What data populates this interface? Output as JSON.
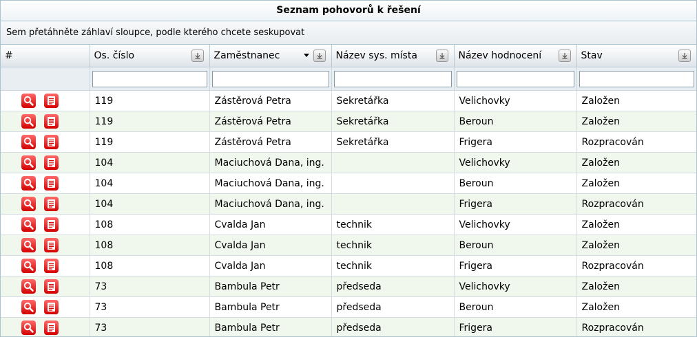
{
  "title": "Seznam pohovorů k řešení",
  "group_hint": "Sem přetáhněte záhlaví sloupce, podle kterého chcete seskupovat",
  "columns": [
    {
      "label": "#"
    },
    {
      "label": "Os. číslo"
    },
    {
      "label": "Zaměstnanec"
    },
    {
      "label": "Název sys. místa"
    },
    {
      "label": "Název hodnocení"
    },
    {
      "label": "Stav"
    }
  ],
  "rows": [
    {
      "os": "119",
      "emp": "Zástěrová Petra",
      "place": "Sekretářka",
      "eval": "Velichovky",
      "state": "Založen"
    },
    {
      "os": "119",
      "emp": "Zástěrová Petra",
      "place": "Sekretářka",
      "eval": "Beroun",
      "state": "Založen"
    },
    {
      "os": "119",
      "emp": "Zástěrová Petra",
      "place": "Sekretářka",
      "eval": "Frigera",
      "state": "Rozpracován"
    },
    {
      "os": "104",
      "emp": "Maciuchová Dana, ing.",
      "place": "",
      "eval": "Velichovky",
      "state": "Založen"
    },
    {
      "os": "104",
      "emp": "Maciuchová Dana, ing.",
      "place": "",
      "eval": "Beroun",
      "state": "Založen"
    },
    {
      "os": "104",
      "emp": "Maciuchová Dana, ing.",
      "place": "",
      "eval": "Frigera",
      "state": "Rozpracován"
    },
    {
      "os": "108",
      "emp": "Cvalda Jan",
      "place": "technik",
      "eval": "Velichovky",
      "state": "Založen"
    },
    {
      "os": "108",
      "emp": "Cvalda Jan",
      "place": "technik",
      "eval": "Beroun",
      "state": "Založen"
    },
    {
      "os": "108",
      "emp": "Cvalda Jan",
      "place": "technik",
      "eval": "Frigera",
      "state": "Rozpracován"
    },
    {
      "os": "73",
      "emp": "Bambula Petr",
      "place": "předseda",
      "eval": "Velichovky",
      "state": "Založen"
    },
    {
      "os": "73",
      "emp": "Bambula Petr",
      "place": "předseda",
      "eval": "Beroun",
      "state": "Založen"
    },
    {
      "os": "73",
      "emp": "Bambula Petr",
      "place": "předseda",
      "eval": "Frigera",
      "state": "Rozpracován"
    }
  ],
  "icons": {
    "view": "magnifier-icon",
    "detail": "document-icon",
    "column_menu": "column-menu-icon",
    "sort": "sort-descending-icon"
  },
  "colors": {
    "accent_icon": "#d40000",
    "alt_row": "#f0f8ed",
    "border": "#a9c3d1"
  }
}
